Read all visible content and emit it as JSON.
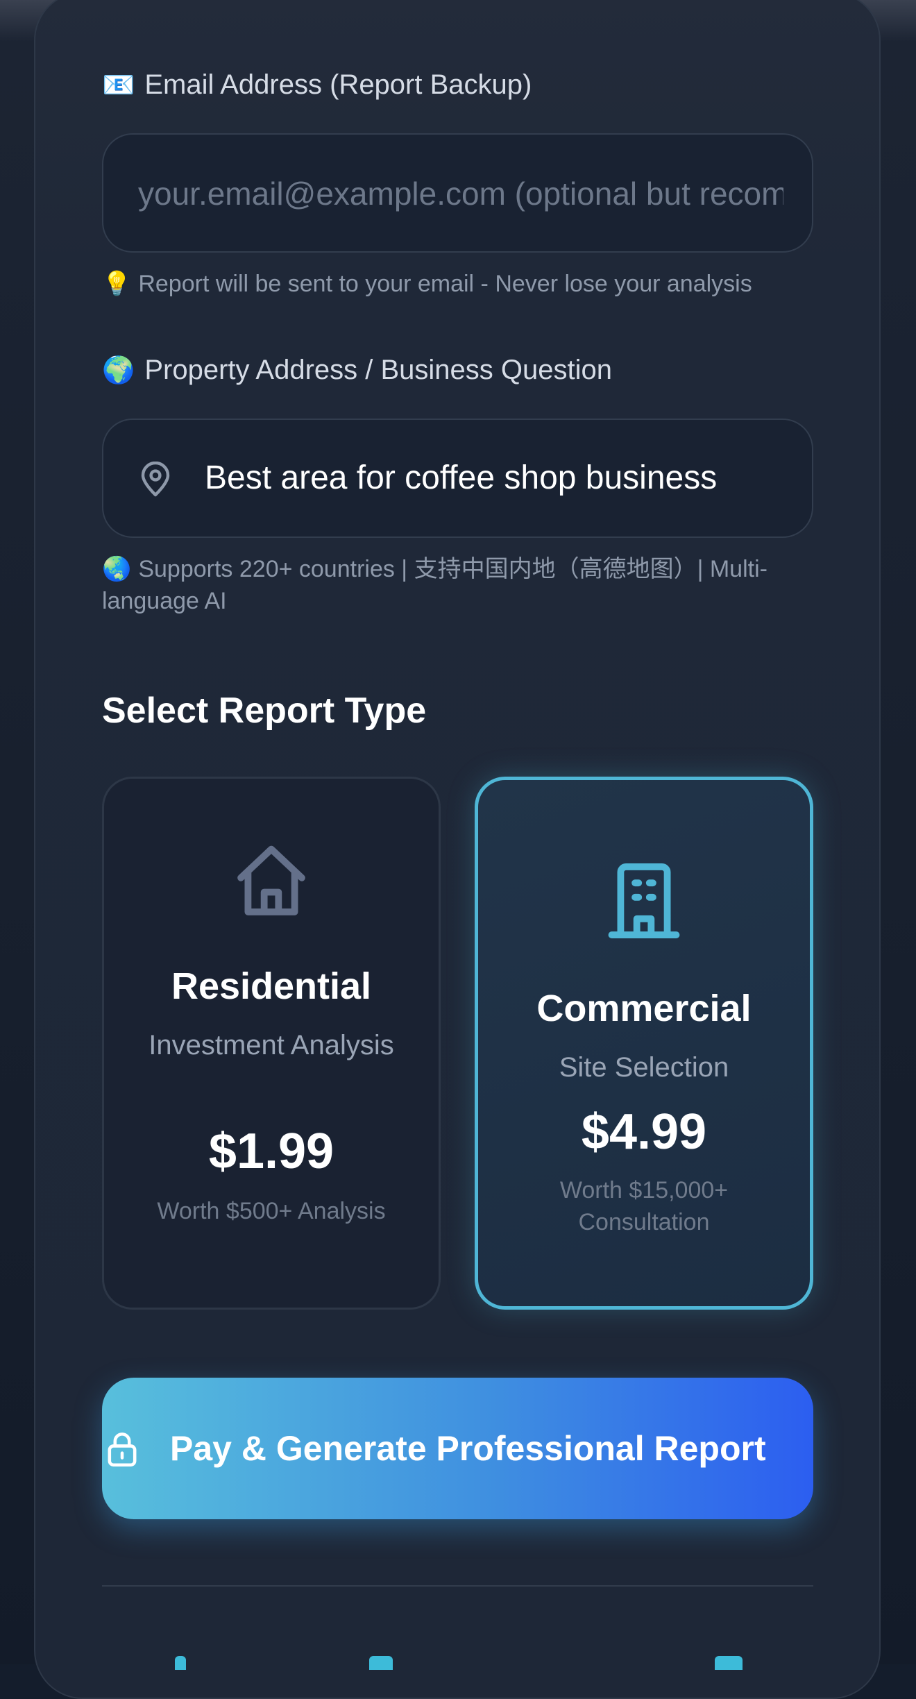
{
  "email": {
    "label": "Email Address (Report Backup)",
    "label_icon": "📧",
    "placeholder": "your.email@example.com (optional but recommended)",
    "value": "",
    "hint_icon": "💡",
    "hint": "Report will be sent to your email - Never lose your analysis"
  },
  "address": {
    "label": "Property Address / Business Question",
    "label_icon": "🌍",
    "icon": "map-pin-icon",
    "value": "Best area for coffee shop business",
    "hint_icon": "🌏",
    "hint": "Supports 220+ countries | 支持中国内地（高德地图）| Multi-language AI"
  },
  "report_type": {
    "title": "Select Report Type",
    "selected": "commercial",
    "options": [
      {
        "id": "residential",
        "icon": "house-icon",
        "title": "Residential",
        "subtitle": "Investment Analysis",
        "price": "$1.99",
        "worth": "Worth $500+ Analysis"
      },
      {
        "id": "commercial",
        "icon": "building-icon",
        "title": "Commercial",
        "subtitle": "Site Selection",
        "price": "$4.99",
        "worth": "Worth $15,000+ Consultation"
      }
    ]
  },
  "pay_button": {
    "icon": "lock-icon",
    "label": "Pay & Generate Professional Report"
  },
  "colors": {
    "accent": "#4fb6d6",
    "button_start": "#58bfdc",
    "button_end": "#2c5ef0",
    "background": "#1e2737"
  }
}
